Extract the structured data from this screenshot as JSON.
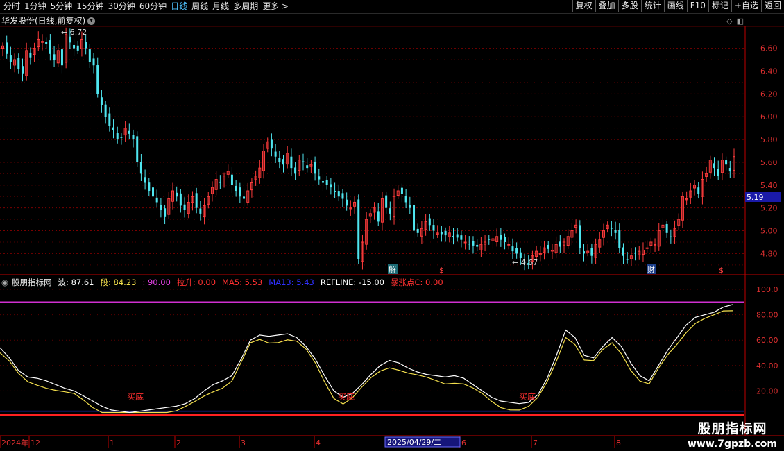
{
  "toolbar": {
    "periods": [
      "分时",
      "1分钟",
      "5分钟",
      "15分钟",
      "30分钟",
      "60分钟",
      "日线",
      "周线",
      "月线",
      "多周期",
      "更多 >"
    ],
    "active_period": "日线",
    "right_buttons": [
      "复权",
      "叠加",
      "多股",
      "统计",
      "画线",
      "F10",
      "标记",
      "+自选",
      "返回"
    ]
  },
  "chart_title": "华发股份(日线,前复权)",
  "price_axis_labels": [
    "6.60",
    "6.40",
    "6.20",
    "6.00",
    "5.80",
    "5.60",
    "5.40",
    "5.20",
    "5.00",
    "4.80"
  ],
  "current_price_tag": "5.19",
  "max_annotation": "6.72",
  "min_annotation": "4.67",
  "event_markers": {
    "jie": "解",
    "dollar1": "$",
    "cai": "财",
    "dollar2": "$"
  },
  "indicator": {
    "name": "股朋指标网",
    "fields": [
      {
        "label": "波:",
        "value": "87.61",
        "color": "#ffffff"
      },
      {
        "label": "段:",
        "value": "84.23",
        "color": "#f4e04d"
      },
      {
        "label": ":",
        "value": "90.00",
        "color": "#e040e0"
      },
      {
        "label": "拉升:",
        "value": "0.00",
        "color": "#ff3030"
      },
      {
        "label": "MA5:",
        "value": "5.53",
        "color": "#ff3030"
      },
      {
        "label": "MA13:",
        "value": "5.43",
        "color": "#3030ff"
      },
      {
        "label": "REFLINE:",
        "value": "-15.00",
        "color": "#ffffff"
      },
      {
        "label": "暴涨点C:",
        "value": "0.00",
        "color": "#ff3030"
      }
    ],
    "axis_labels": [
      "100.0",
      "80.00",
      "60.00",
      "40.00",
      "20.00"
    ],
    "buy_label": "买底"
  },
  "time_axis": {
    "labels": [
      "2024年",
      "12",
      "1",
      "2",
      "3",
      "4",
      "6",
      "7",
      "8"
    ],
    "highlight": "2025/04/29/二"
  },
  "watermark": {
    "line1": "股朋指标网",
    "line2": "www.7gpzb.com"
  },
  "chart_data": {
    "type": "candlestick",
    "title": "华发股份(日线,前复权)",
    "ylim": [
      4.62,
      6.78
    ],
    "closes": [
      6.62,
      6.55,
      6.48,
      6.5,
      6.42,
      6.38,
      6.58,
      6.52,
      6.6,
      6.68,
      6.66,
      6.64,
      6.55,
      6.5,
      6.58,
      6.45,
      6.72,
      6.65,
      6.6,
      6.58,
      6.68,
      6.6,
      6.48,
      6.45,
      6.2,
      6.1,
      6.0,
      5.92,
      5.88,
      5.8,
      5.82,
      5.9,
      5.85,
      5.8,
      5.6,
      5.5,
      5.42,
      5.35,
      5.3,
      5.25,
      5.18,
      5.12,
      5.28,
      5.35,
      5.3,
      5.22,
      5.18,
      5.25,
      5.3,
      5.2,
      5.15,
      5.22,
      5.3,
      5.38,
      5.45,
      5.42,
      5.48,
      5.52,
      5.4,
      5.35,
      5.3,
      5.28,
      5.35,
      5.42,
      5.48,
      5.55,
      5.7,
      5.78,
      5.72,
      5.65,
      5.6,
      5.58,
      5.68,
      5.55,
      5.5,
      5.62,
      5.6,
      5.55,
      5.58,
      5.5,
      5.45,
      5.42,
      5.4,
      5.38,
      5.35,
      5.3,
      5.28,
      5.22,
      5.2,
      5.25,
      4.75,
      4.9,
      5.1,
      5.15,
      5.2,
      5.08,
      5.28,
      5.2,
      5.15,
      5.3,
      5.35,
      5.32,
      5.25,
      5.2,
      5.0,
      4.98,
      5.02,
      5.08,
      5.05,
      5.0,
      4.98,
      4.97,
      4.96,
      4.98,
      4.95,
      4.94,
      4.92,
      4.9,
      4.88,
      4.87,
      4.86,
      4.88,
      4.9,
      4.92,
      4.93,
      4.95,
      4.92,
      4.9,
      4.88,
      4.82,
      4.8,
      4.76,
      4.72,
      4.7,
      4.78,
      4.82,
      4.8,
      4.85,
      4.84,
      4.83,
      4.88,
      4.86,
      4.9,
      4.95,
      5.0,
      5.05,
      4.85,
      4.8,
      4.82,
      4.78,
      4.88,
      4.92,
      5.0,
      5.05,
      5.02,
      4.98,
      4.85,
      4.78,
      4.75,
      4.78,
      4.8,
      4.82,
      4.83,
      4.85,
      4.9,
      4.88,
      5.0,
      5.05,
      4.98,
      4.95,
      5.02,
      5.1,
      5.3,
      5.28,
      5.35,
      5.4,
      5.32,
      5.45,
      5.5,
      5.62,
      5.55,
      5.48,
      5.62,
      5.58,
      5.52,
      5.65
    ]
  }
}
